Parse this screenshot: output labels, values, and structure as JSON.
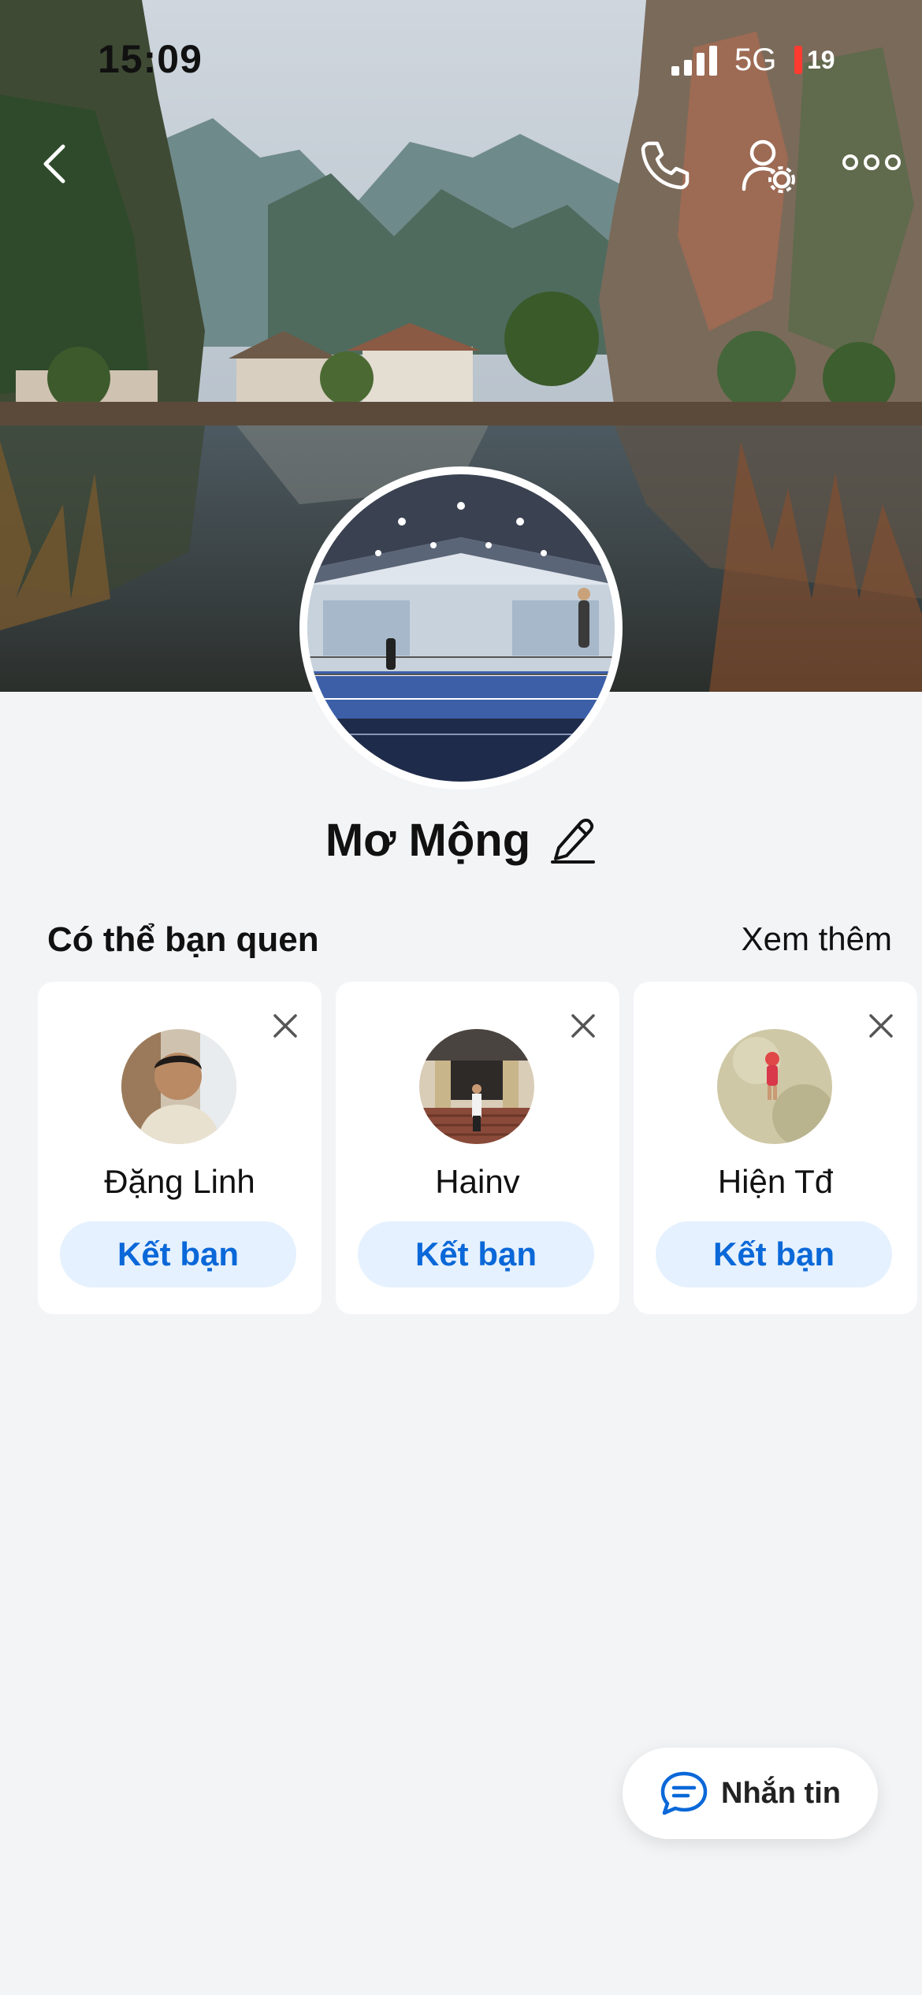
{
  "status_bar": {
    "time": "15:09",
    "network": "5G",
    "battery": "19",
    "battery_color": "#ff3b30"
  },
  "nav": {
    "back_icon": "chevron-left-icon",
    "call_icon": "phone-icon",
    "settings_icon": "user-settings-icon",
    "more_icon": "more-dots-icon"
  },
  "profile": {
    "name": "Mơ Mộng",
    "edit_icon": "pencil-icon"
  },
  "suggestions": {
    "title": "Có thể bạn quen",
    "see_more": "Xem thêm",
    "people": [
      {
        "name": "Đặng Linh",
        "button": "Kết bạn"
      },
      {
        "name": "Hainv",
        "button": "Kết bạn"
      },
      {
        "name": "Hiện Tđ",
        "button": "Kết bạn"
      }
    ]
  },
  "floating": {
    "label": "Nhắn tin",
    "icon": "chat-bubble-icon"
  },
  "colors": {
    "accent": "#0a68d8",
    "button_bg": "#e5f1fe",
    "page_bg": "#f3f4f6"
  }
}
